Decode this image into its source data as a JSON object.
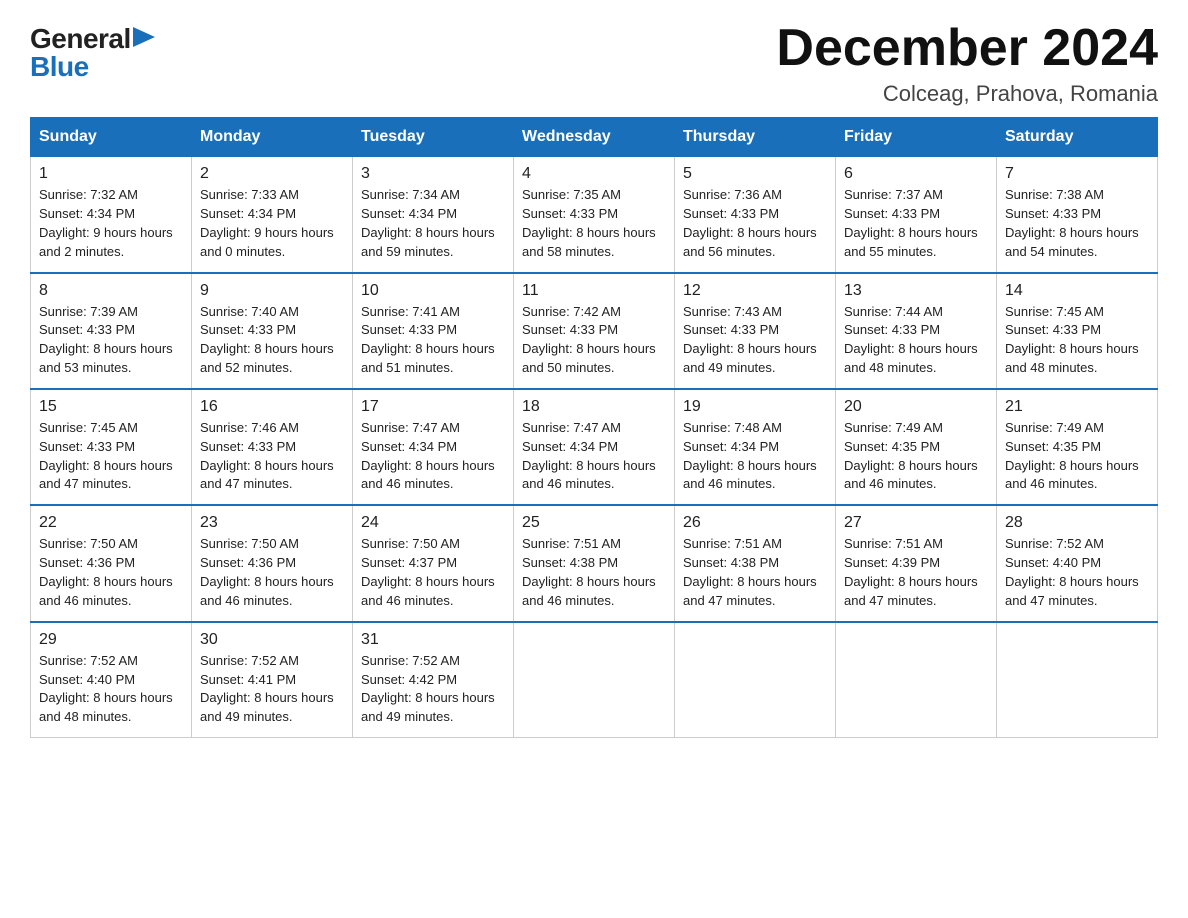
{
  "logo": {
    "general": "General",
    "triangle": "▶",
    "blue": "Blue"
  },
  "title": {
    "month": "December 2024",
    "location": "Colceag, Prahova, Romania"
  },
  "days_header": [
    "Sunday",
    "Monday",
    "Tuesday",
    "Wednesday",
    "Thursday",
    "Friday",
    "Saturday"
  ],
  "weeks": [
    [
      {
        "day": "1",
        "sunrise": "7:32 AM",
        "sunset": "4:34 PM",
        "daylight": "9 hours and 2 minutes."
      },
      {
        "day": "2",
        "sunrise": "7:33 AM",
        "sunset": "4:34 PM",
        "daylight": "9 hours and 0 minutes."
      },
      {
        "day": "3",
        "sunrise": "7:34 AM",
        "sunset": "4:34 PM",
        "daylight": "8 hours and 59 minutes."
      },
      {
        "day": "4",
        "sunrise": "7:35 AM",
        "sunset": "4:33 PM",
        "daylight": "8 hours and 58 minutes."
      },
      {
        "day": "5",
        "sunrise": "7:36 AM",
        "sunset": "4:33 PM",
        "daylight": "8 hours and 56 minutes."
      },
      {
        "day": "6",
        "sunrise": "7:37 AM",
        "sunset": "4:33 PM",
        "daylight": "8 hours and 55 minutes."
      },
      {
        "day": "7",
        "sunrise": "7:38 AM",
        "sunset": "4:33 PM",
        "daylight": "8 hours and 54 minutes."
      }
    ],
    [
      {
        "day": "8",
        "sunrise": "7:39 AM",
        "sunset": "4:33 PM",
        "daylight": "8 hours and 53 minutes."
      },
      {
        "day": "9",
        "sunrise": "7:40 AM",
        "sunset": "4:33 PM",
        "daylight": "8 hours and 52 minutes."
      },
      {
        "day": "10",
        "sunrise": "7:41 AM",
        "sunset": "4:33 PM",
        "daylight": "8 hours and 51 minutes."
      },
      {
        "day": "11",
        "sunrise": "7:42 AM",
        "sunset": "4:33 PM",
        "daylight": "8 hours and 50 minutes."
      },
      {
        "day": "12",
        "sunrise": "7:43 AM",
        "sunset": "4:33 PM",
        "daylight": "8 hours and 49 minutes."
      },
      {
        "day": "13",
        "sunrise": "7:44 AM",
        "sunset": "4:33 PM",
        "daylight": "8 hours and 48 minutes."
      },
      {
        "day": "14",
        "sunrise": "7:45 AM",
        "sunset": "4:33 PM",
        "daylight": "8 hours and 48 minutes."
      }
    ],
    [
      {
        "day": "15",
        "sunrise": "7:45 AM",
        "sunset": "4:33 PM",
        "daylight": "8 hours and 47 minutes."
      },
      {
        "day": "16",
        "sunrise": "7:46 AM",
        "sunset": "4:33 PM",
        "daylight": "8 hours and 47 minutes."
      },
      {
        "day": "17",
        "sunrise": "7:47 AM",
        "sunset": "4:34 PM",
        "daylight": "8 hours and 46 minutes."
      },
      {
        "day": "18",
        "sunrise": "7:47 AM",
        "sunset": "4:34 PM",
        "daylight": "8 hours and 46 minutes."
      },
      {
        "day": "19",
        "sunrise": "7:48 AM",
        "sunset": "4:34 PM",
        "daylight": "8 hours and 46 minutes."
      },
      {
        "day": "20",
        "sunrise": "7:49 AM",
        "sunset": "4:35 PM",
        "daylight": "8 hours and 46 minutes."
      },
      {
        "day": "21",
        "sunrise": "7:49 AM",
        "sunset": "4:35 PM",
        "daylight": "8 hours and 46 minutes."
      }
    ],
    [
      {
        "day": "22",
        "sunrise": "7:50 AM",
        "sunset": "4:36 PM",
        "daylight": "8 hours and 46 minutes."
      },
      {
        "day": "23",
        "sunrise": "7:50 AM",
        "sunset": "4:36 PM",
        "daylight": "8 hours and 46 minutes."
      },
      {
        "day": "24",
        "sunrise": "7:50 AM",
        "sunset": "4:37 PM",
        "daylight": "8 hours and 46 minutes."
      },
      {
        "day": "25",
        "sunrise": "7:51 AM",
        "sunset": "4:38 PM",
        "daylight": "8 hours and 46 minutes."
      },
      {
        "day": "26",
        "sunrise": "7:51 AM",
        "sunset": "4:38 PM",
        "daylight": "8 hours and 47 minutes."
      },
      {
        "day": "27",
        "sunrise": "7:51 AM",
        "sunset": "4:39 PM",
        "daylight": "8 hours and 47 minutes."
      },
      {
        "day": "28",
        "sunrise": "7:52 AM",
        "sunset": "4:40 PM",
        "daylight": "8 hours and 47 minutes."
      }
    ],
    [
      {
        "day": "29",
        "sunrise": "7:52 AM",
        "sunset": "4:40 PM",
        "daylight": "8 hours and 48 minutes."
      },
      {
        "day": "30",
        "sunrise": "7:52 AM",
        "sunset": "4:41 PM",
        "daylight": "8 hours and 49 minutes."
      },
      {
        "day": "31",
        "sunrise": "7:52 AM",
        "sunset": "4:42 PM",
        "daylight": "8 hours and 49 minutes."
      },
      null,
      null,
      null,
      null
    ]
  ]
}
